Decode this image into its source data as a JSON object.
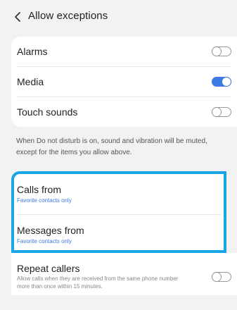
{
  "header": {
    "title": "Allow exceptions",
    "back_icon": "chevron-left-icon"
  },
  "exceptions": {
    "items": [
      {
        "label": "Alarms",
        "on": false
      },
      {
        "label": "Media",
        "on": true
      },
      {
        "label": "Touch sounds",
        "on": false
      }
    ]
  },
  "info": {
    "text": "When Do not disturb is on, sound and vibration will be muted, except for the items you allow above."
  },
  "calls_from": {
    "label": "Calls from",
    "value": "Favorite contacts only"
  },
  "messages_from": {
    "label": "Messages from",
    "value": "Favorite contacts only"
  },
  "repeat_callers": {
    "label": "Repeat callers",
    "description": "Allow calls when they are received from the same phone number more than once within 15 minutes.",
    "on": false
  },
  "colors": {
    "accent": "#3d7ae5",
    "highlight_border": "#18a6e6",
    "background": "#f2f2f2"
  }
}
